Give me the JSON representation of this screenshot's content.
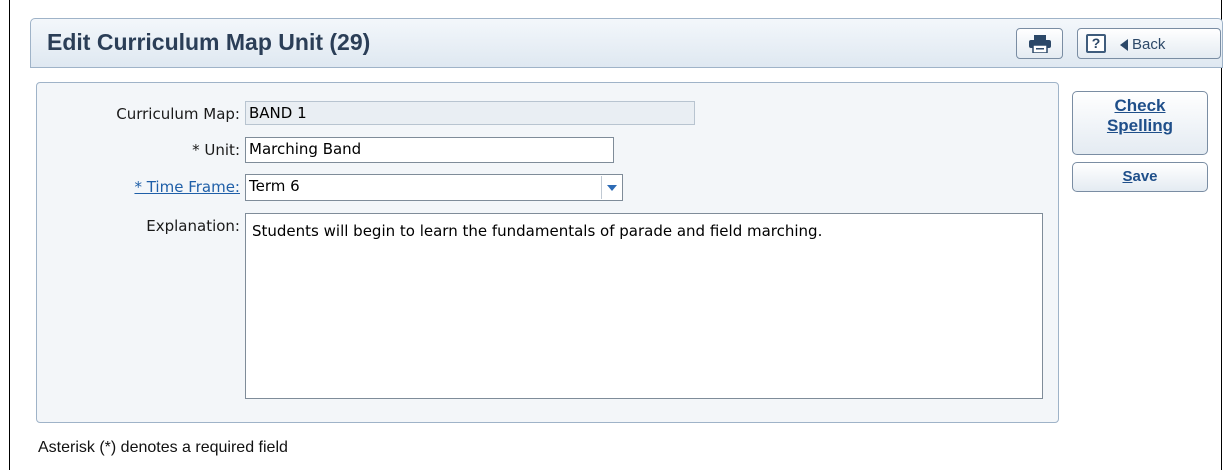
{
  "header": {
    "title": "Edit Curriculum Map Unit (29)",
    "print_icon": "printer-icon",
    "help_label": "?",
    "back_label": "Back"
  },
  "form": {
    "curriculum_map_label": "Curriculum Map:",
    "curriculum_map_value": "BAND 1",
    "unit_label": "* Unit:",
    "unit_value": "Marching Band",
    "time_frame_label": "* Time Frame:",
    "time_frame_value": "Term 6",
    "explanation_label": "Explanation:",
    "explanation_value": "Students will begin to learn the fundamentals of parade and field marching."
  },
  "actions": {
    "check_line1": "Check",
    "check_line2": "Spelling",
    "save_first": "S",
    "save_rest": "ave"
  },
  "footer": {
    "note": "Asterisk (*) denotes a required field"
  },
  "colors": {
    "accent": "#1f4f8a",
    "link": "#1f5fa8",
    "panel_bg": "#f3f6f9",
    "readonly_bg": "#e9eef3"
  }
}
